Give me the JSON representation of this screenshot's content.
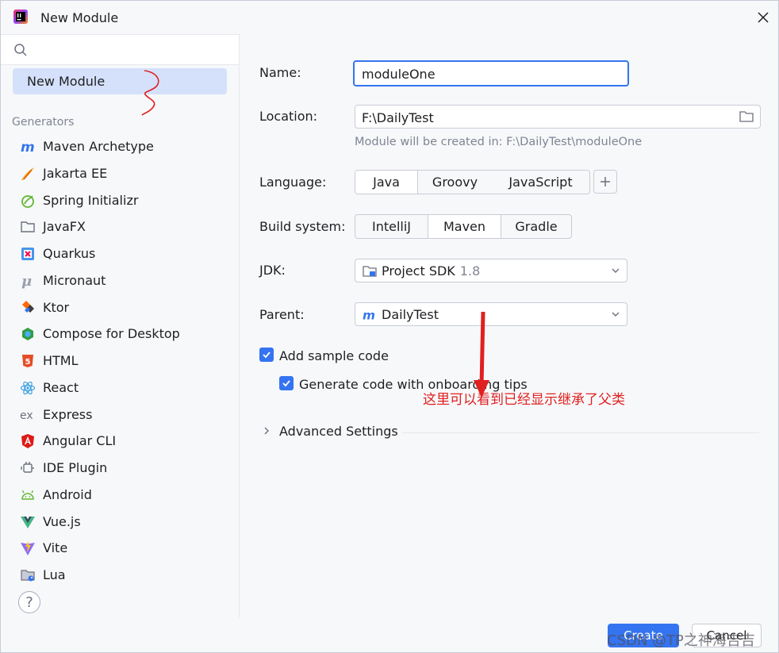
{
  "window": {
    "title": "New Module"
  },
  "search": {
    "placeholder": ""
  },
  "sidebar": {
    "selected": "New Module",
    "section_label": "Generators",
    "generators": [
      {
        "label": "Maven Archetype",
        "icon": "maven-icon",
        "color": "#3574f0"
      },
      {
        "label": "Jakarta EE",
        "icon": "jakarta-icon",
        "color": "#f4a623"
      },
      {
        "label": "Spring Initializr",
        "icon": "spring-icon",
        "color": "#5fb832"
      },
      {
        "label": "JavaFX",
        "icon": "folder-icon",
        "color": "#6c707e"
      },
      {
        "label": "Quarkus",
        "icon": "quarkus-icon",
        "color": "#4695eb"
      },
      {
        "label": "Micronaut",
        "icon": "micronaut-icon",
        "color": "#9aa0ad"
      },
      {
        "label": "Ktor",
        "icon": "ktor-icon",
        "color": "#ff6b00"
      },
      {
        "label": "Compose for Desktop",
        "icon": "compose-icon",
        "color": "#2f9e44"
      },
      {
        "label": "HTML",
        "icon": "html5-icon",
        "color": "#e44d26"
      },
      {
        "label": "React",
        "icon": "react-icon",
        "color": "#3da0e0"
      },
      {
        "label": "Express",
        "icon": "express-icon",
        "color": "#6c707e"
      },
      {
        "label": "Angular CLI",
        "icon": "angular-icon",
        "color": "#dd1b16"
      },
      {
        "label": "IDE Plugin",
        "icon": "plugin-icon",
        "color": "#6c707e"
      },
      {
        "label": "Android",
        "icon": "android-icon",
        "color": "#5fb832"
      },
      {
        "label": "Vue.js",
        "icon": "vue-icon",
        "color": "#41b883"
      },
      {
        "label": "Vite",
        "icon": "vite-icon",
        "color": "#8f6cf5"
      },
      {
        "label": "Lua",
        "icon": "lua-icon",
        "color": "#6c707e"
      }
    ]
  },
  "form": {
    "name_label": "Name:",
    "name_value": "moduleOne",
    "location_label": "Location:",
    "location_value": "F:\\DailyTest",
    "location_hint": "Module will be created in: F:\\DailyTest\\moduleOne",
    "language_label": "Language:",
    "languages": [
      "Java",
      "Groovy",
      "JavaScript"
    ],
    "language_selected": "Java",
    "build_label": "Build system:",
    "build_systems": [
      "IntelliJ",
      "Maven",
      "Gradle"
    ],
    "build_selected": "Maven",
    "jdk_label": "JDK:",
    "jdk_value": "Project SDK",
    "jdk_version": "1.8",
    "parent_label": "Parent:",
    "parent_value": "DailyTest",
    "sample_code_label": "Add sample code",
    "onboarding_label": "Generate code with onboarding tips",
    "advanced_label": "Advanced Settings",
    "annotation": "这里可以看到已经显示继承了父类"
  },
  "footer": {
    "help": "?",
    "create": "Create",
    "cancel": "Cancel",
    "watermark": "CSDN @TP之神海吉吉"
  },
  "colors": {
    "accent": "#3574f0",
    "selection": "#d5e1fb",
    "annotation": "#e02020"
  }
}
